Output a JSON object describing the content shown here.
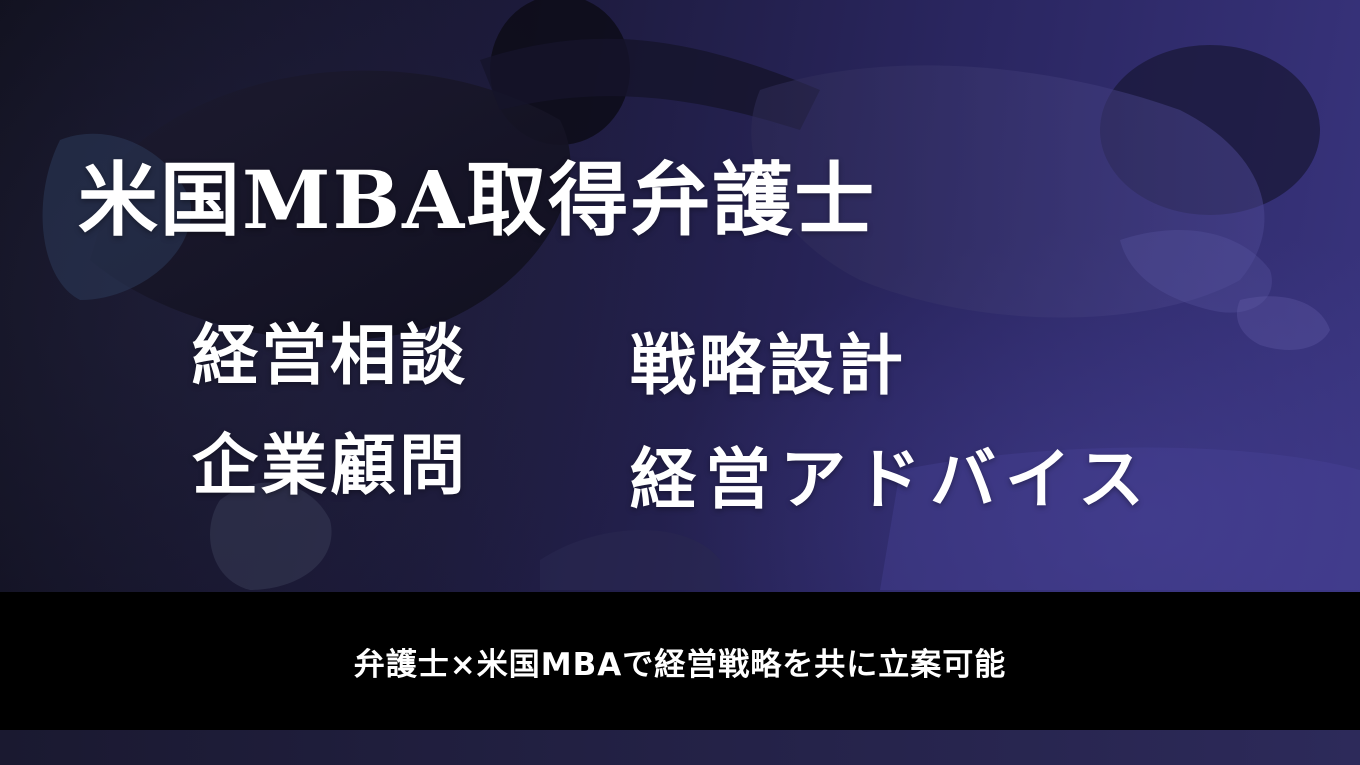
{
  "banner": {
    "title": "米国MBA取得弁護士",
    "services": [
      "経営相談",
      "企業顧問",
      "戦略設計",
      "経営アドバイス"
    ],
    "tagline": "弁護士×米国MBAで経営戦略を共に立案可能",
    "colors": {
      "overlay": "#2a2660",
      "bar": "#000000",
      "text": "#ffffff"
    }
  }
}
